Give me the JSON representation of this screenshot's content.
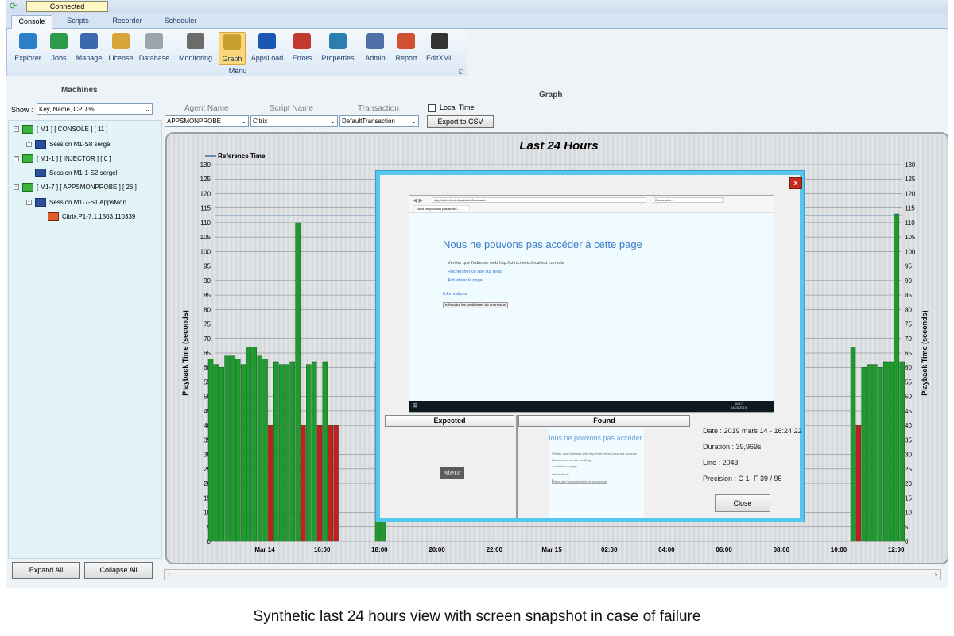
{
  "connection": {
    "status": "Connected",
    "icon": "refresh-icon"
  },
  "tabs": [
    {
      "label": "Console",
      "active": true
    },
    {
      "label": "Scripts",
      "active": false
    },
    {
      "label": "Recorder",
      "active": false
    },
    {
      "label": "Scheduler",
      "active": false
    }
  ],
  "ribbon": {
    "group_label": "Menu",
    "buttons": [
      {
        "label": "Explorer",
        "icon": "explorer-icon",
        "color": "#2e7fc9"
      },
      {
        "label": "Jobs",
        "icon": "jobs-icon",
        "color": "#2e9a4a"
      },
      {
        "label": "Manage",
        "icon": "manage-icon",
        "color": "#3c68b0"
      },
      {
        "label": "License",
        "icon": "license-icon",
        "color": "#d9a43a"
      },
      {
        "label": "Database",
        "icon": "database-icon",
        "color": "#9aa4ad"
      },
      {
        "label": "Monitoring",
        "icon": "monitoring-icon",
        "color": "#6b6b6b"
      },
      {
        "label": "Graph",
        "icon": "graph-icon",
        "color": "#c8a030",
        "active": true
      },
      {
        "label": "AppsLoad",
        "icon": "appsload-icon",
        "color": "#1c56b4"
      },
      {
        "label": "Errors",
        "icon": "errors-icon",
        "color": "#c23a30"
      },
      {
        "label": "Properties",
        "icon": "properties-icon",
        "color": "#2a7fb0"
      },
      {
        "label": "Admin",
        "icon": "admin-icon",
        "color": "#4f6fa8"
      },
      {
        "label": "Report",
        "icon": "report-icon",
        "color": "#d05030"
      },
      {
        "label": "EditXML",
        "icon": "editxml-icon",
        "color": "#333333"
      }
    ]
  },
  "machines": {
    "title": "Machines",
    "show_label": "Show :",
    "show_value": "Key, Name, CPU %",
    "tree": [
      {
        "label": "[ M1 ] [ CONSOLE ] [ 11 ]",
        "level": 0,
        "expander": "⊟"
      },
      {
        "label": "Session M1-S8 sergel",
        "level": 1,
        "expander": "⊞"
      },
      {
        "label": "[ M1-1 ] [ INJECTOR ] [ 0 ]",
        "level": 0,
        "expander": "⊟"
      },
      {
        "label": "Session M1-1-S2 sergel",
        "level": 1,
        "expander": ""
      },
      {
        "label": "[ M1-7 ] [ APPSMONPROBE ] [ 26 ]",
        "level": 0,
        "expander": "⊟"
      },
      {
        "label": "Session M1-7-S1 AppsMon",
        "level": 1,
        "expander": "⊟"
      },
      {
        "label": "Citrix.P1-7.1.1503.110339",
        "level": 2,
        "expander": ""
      }
    ],
    "expand_all": "Expand All",
    "collapse_all": "Collapse All"
  },
  "graph_panel": {
    "title": "Graph",
    "agent_label": "Agent Name",
    "agent_value": "APPSMONPROBE",
    "script_label": "Script Name",
    "script_value": "Citrix",
    "transaction_label": "Transaction",
    "transaction_value": "DefaultTransaction",
    "local_time_label": "Local Time",
    "local_time_checked": false,
    "export_button": "Export to CSV"
  },
  "chart_data": {
    "type": "bar",
    "title": "Last 24 Hours",
    "ylabel": "Playback Time (seconds)",
    "ylabel_right": "Playback Time (seconds)",
    "legend": "Reference Time",
    "legend_position": "top-left",
    "reference_value": 112.5,
    "ylim": [
      0,
      130
    ],
    "yticks": [
      0,
      5,
      10,
      15,
      20,
      25,
      30,
      35,
      40,
      45,
      50,
      55,
      60,
      65,
      70,
      75,
      80,
      85,
      90,
      95,
      100,
      105,
      110,
      115,
      120,
      125,
      130
    ],
    "xticks": [
      "Mar 14",
      "16:00",
      "18:00",
      "20:00",
      "22:00",
      "Mar 15",
      "02:00",
      "04:00",
      "06:00",
      "08:00",
      "10:00",
      "12:00"
    ],
    "grid": true,
    "colors": {
      "ok": "#1e9a2e",
      "error": "#c41e1e",
      "reference": "#4a6fa5"
    },
    "series": [
      {
        "name": "",
        "bars": [
          {
            "value": 63,
            "status": "ok"
          },
          {
            "value": 61,
            "status": "ok"
          },
          {
            "value": 60,
            "status": "ok"
          },
          {
            "value": 64,
            "status": "ok"
          },
          {
            "value": 64,
            "status": "ok"
          },
          {
            "value": 63,
            "status": "ok"
          },
          {
            "value": 61,
            "status": "ok"
          },
          {
            "value": 67,
            "status": "ok"
          },
          {
            "value": 67,
            "status": "ok"
          },
          {
            "value": 64,
            "status": "ok"
          },
          {
            "value": 63,
            "status": "ok"
          },
          {
            "value": 40,
            "status": "error"
          },
          {
            "value": 62,
            "status": "ok"
          },
          {
            "value": 61,
            "status": "ok"
          },
          {
            "value": 61,
            "status": "ok"
          },
          {
            "value": 62,
            "status": "ok"
          },
          {
            "value": 110,
            "status": "ok"
          },
          {
            "value": 40,
            "status": "error"
          },
          {
            "value": 61,
            "status": "ok"
          },
          {
            "value": 62,
            "status": "ok"
          },
          {
            "value": 40,
            "status": "error"
          },
          {
            "value": 62,
            "status": "ok"
          },
          {
            "value": 40,
            "status": "error"
          },
          {
            "value": 40,
            "status": "error"
          },
          {
            "value": 62,
            "status": "ok"
          },
          {
            "value": 62,
            "status": "ok"
          },
          {
            "value": 67,
            "status": "ok"
          },
          {
            "value": 40,
            "status": "error"
          },
          {
            "value": 60,
            "status": "ok"
          },
          {
            "value": 61,
            "status": "ok"
          },
          {
            "value": 61,
            "status": "ok"
          },
          {
            "value": 60,
            "status": "ok"
          },
          {
            "value": 62,
            "status": "ok"
          },
          {
            "value": 62,
            "status": "ok"
          },
          {
            "value": 113,
            "status": "ok"
          },
          {
            "value": 62,
            "status": "ok"
          }
        ]
      }
    ]
  },
  "failure_popup": {
    "close_x": "x",
    "snapshot": {
      "address": "http://citrix.itexis.local/citrix/itexisweb",
      "search_placeholder": "Rechercher...",
      "tab_title": "Nous ne pouvons pas accéd...",
      "error_title": "Nous ne pouvons pas accéder à cette page",
      "bullets": [
        "Vérifier que l'adresse web http://citrix.itexis.local est correcte",
        "Rechercher ce site sur Bing",
        "Actualiser la page"
      ],
      "info_link": "Informations",
      "fix_button": "Résoudre les problèmes de connexion",
      "taskbar_time": "16:17",
      "taskbar_date": "14/03/2019"
    },
    "expected_label": "Expected",
    "found_label": "Found",
    "expected_crop_text": "ateur",
    "found_crop_text": "Nous ne pouvons pas accéder à cette page",
    "date": "Date : 2019 mars 14 - 16:24:22",
    "duration": "Duration : 39,969s",
    "line": "Line : 2043",
    "precision": "Precision : C 1- F 39 / 95",
    "close_button": "Close"
  },
  "caption": "Synthetic last 24 hours view with screen snapshot in case of failure"
}
